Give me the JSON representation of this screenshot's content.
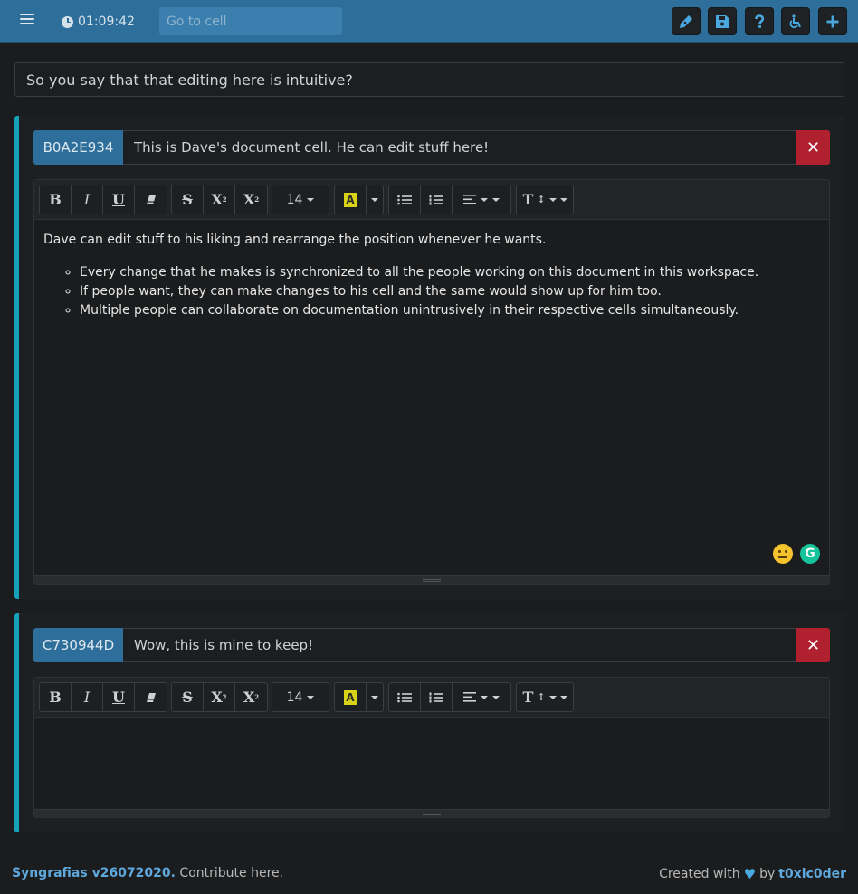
{
  "navbar": {
    "menu_icon": "hamburger-icon",
    "clock_icon": "clock-icon",
    "timer": "01:09:42",
    "goto_placeholder": "Go to cell",
    "buttons": [
      {
        "name": "edit-pen-button",
        "icon": "pen-icon"
      },
      {
        "name": "save-button",
        "icon": "floppy-disk-icon"
      },
      {
        "name": "help-button",
        "icon": "question-icon"
      },
      {
        "name": "accessibility-button",
        "icon": "wheelchair-icon"
      },
      {
        "name": "add-cell-button",
        "icon": "plus-icon"
      }
    ]
  },
  "workspace": {
    "title": "So you say that that editing here is intuitive?"
  },
  "toolbar": {
    "bold": "B",
    "italic": "I",
    "underline": "U",
    "strike": "S",
    "superscript_base": "X",
    "superscript_mark": "2",
    "subscript_base": "X",
    "subscript_mark": "2",
    "font_size": "14",
    "highlight_letter": "A",
    "style_label": "T"
  },
  "cells": [
    {
      "id": "B0A2E934",
      "title": "This is Dave's document cell. He can edit stuff here!",
      "close_icon": "close-x-icon",
      "body_paragraph": "Dave can edit stuff to his liking and rearrange the position whenever he wants.",
      "bullets": [
        "Every change that he makes is synchronized to all the people working on this document in this workspace.",
        "If people want, they can make changes to his cell and the same would show up for him too.",
        "Multiple people can collaborate on documentation unintrusively in their respective cells simultaneously."
      ],
      "grammarly_letter": "G"
    },
    {
      "id": "C730944D",
      "title": "Wow, this is mine to keep!",
      "close_icon": "close-x-icon"
    }
  ],
  "footer": {
    "brand": "Syngrafias v26072020.",
    "contribute": " Contribute here.",
    "created_with": "Created with",
    "by": "by",
    "author": "t0xic0der"
  },
  "colors": {
    "navbar": "#2d6e9a",
    "accent": "#17a2b8",
    "close": "#b0202e",
    "link": "#5fa8dc"
  }
}
